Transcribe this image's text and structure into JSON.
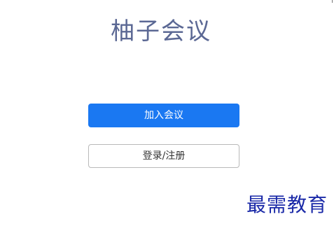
{
  "app": {
    "title": "柚子会议"
  },
  "actions": {
    "join_meeting_label": "加入会议",
    "login_register_label": "登录/注册"
  },
  "watermark": {
    "text": "最需教育"
  },
  "colors": {
    "title": "#5b6894",
    "primary_button": "#1a78f2",
    "secondary_border": "#b9b9b9",
    "watermark": "#1b2aa8"
  }
}
